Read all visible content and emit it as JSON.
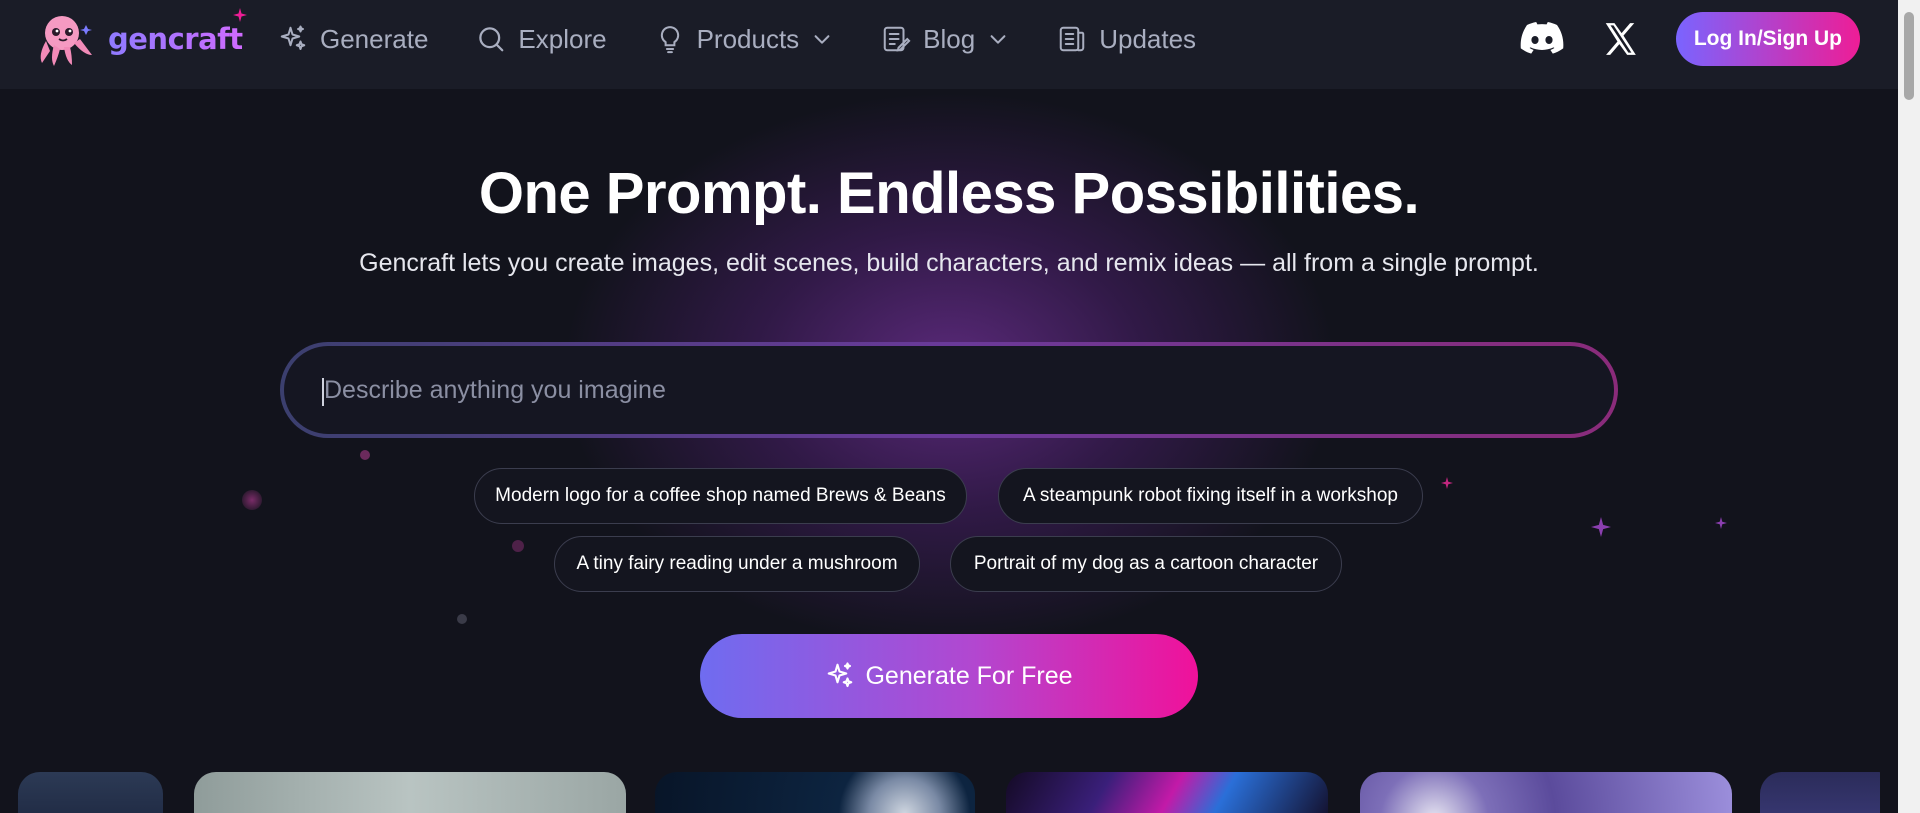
{
  "app": {
    "brand_name": "gencraft",
    "accent_gradient": [
      "#7a64ff",
      "#ee1d96"
    ],
    "background_color": "#12131c"
  },
  "nav": {
    "items": [
      {
        "label": "Generate",
        "icon": "sparkles-icon",
        "has_dropdown": false
      },
      {
        "label": "Explore",
        "icon": "search-icon",
        "has_dropdown": false
      },
      {
        "label": "Products",
        "icon": "lightbulb-icon",
        "has_dropdown": true
      },
      {
        "label": "Blog",
        "icon": "document-edit-icon",
        "has_dropdown": true
      },
      {
        "label": "Updates",
        "icon": "newspaper-icon",
        "has_dropdown": false
      }
    ],
    "social": [
      "discord-icon",
      "x-icon"
    ],
    "login_label": "Log In/Sign Up"
  },
  "hero": {
    "title": "One Prompt. Endless Possibilities.",
    "subtitle": "Gencraft lets you create images, edit scenes, build characters, and remix ideas — all from a single prompt.",
    "prompt_placeholder": "Describe anything you imagine",
    "prompt_value": "",
    "suggestions": [
      "Modern logo for a coffee shop named Brews & Beans",
      "A steampunk robot fixing itself in a workshop",
      "A tiny fairy reading under a mushroom",
      "Portrait of my dog as a cartoon character"
    ],
    "cta_label": "Generate For Free"
  },
  "gallery": {
    "cards": [
      "gallery-card-night-sky",
      "gallery-card-misty-light",
      "gallery-card-moon-space",
      "gallery-card-neon-tunnel",
      "gallery-card-planet-tower",
      "gallery-card-purple"
    ]
  }
}
